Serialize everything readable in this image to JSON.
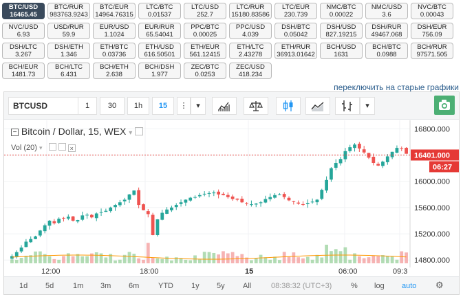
{
  "pairs": [
    {
      "name": "BTC/USD",
      "price": "16465.45",
      "active": true
    },
    {
      "name": "BTC/RUR",
      "price": "983763.9243"
    },
    {
      "name": "BTC/EUR",
      "price": "14964.76315"
    },
    {
      "name": "LTC/BTC",
      "price": "0.01537"
    },
    {
      "name": "LTC/USD",
      "price": "252.7"
    },
    {
      "name": "LTC/RUR",
      "price": "15180.83586"
    },
    {
      "name": "LTC/EUR",
      "price": "230.739"
    },
    {
      "name": "NMC/BTC",
      "price": "0.00022"
    },
    {
      "name": "NMC/USD",
      "price": "3.6"
    },
    {
      "name": "NVC/BTC",
      "price": "0.00043"
    },
    {
      "name": "NVC/USD",
      "price": "6.93"
    },
    {
      "name": "USD/RUR",
      "price": "59.9"
    },
    {
      "name": "EUR/USD",
      "price": "1.1024"
    },
    {
      "name": "EUR/RUR",
      "price": "65.54041"
    },
    {
      "name": "PPC/BTC",
      "price": "0.00025"
    },
    {
      "name": "PPC/USD",
      "price": "4.039"
    },
    {
      "name": "DSH/BTC",
      "price": "0.05042"
    },
    {
      "name": "DSH/USD",
      "price": "827.19215"
    },
    {
      "name": "DSH/RUR",
      "price": "49467.068"
    },
    {
      "name": "DSH/EUR",
      "price": "756.09"
    },
    {
      "name": "DSH/LTC",
      "price": "3.267"
    },
    {
      "name": "DSH/ETH",
      "price": "1.346"
    },
    {
      "name": "ETH/BTC",
      "price": "0.03736"
    },
    {
      "name": "ETH/USD",
      "price": "616.50501"
    },
    {
      "name": "ETH/EUR",
      "price": "561.12415"
    },
    {
      "name": "ETH/LTC",
      "price": "2.43278"
    },
    {
      "name": "ETH/RUR",
      "price": "36913.01642"
    },
    {
      "name": "BCH/USD",
      "price": "1631"
    },
    {
      "name": "BCH/BTC",
      "price": "0.0988"
    },
    {
      "name": "BCH/RUR",
      "price": "97571.505"
    },
    {
      "name": "BCH/EUR",
      "price": "1481.73"
    },
    {
      "name": "BCH/LTC",
      "price": "6.431"
    },
    {
      "name": "BCH/ETH",
      "price": "2.638"
    },
    {
      "name": "BCH/DSH",
      "price": "1.977"
    },
    {
      "name": "ZEC/BTC",
      "price": "0.0253"
    },
    {
      "name": "ZEC/USD",
      "price": "418.234"
    }
  ],
  "switch_link": "переключить на старые графики",
  "toolbar": {
    "symbol": "BTCUSD",
    "intervals": [
      "1",
      "30",
      "1h",
      "15"
    ],
    "active_interval": "15"
  },
  "legend": {
    "title": "Bitcoin / Dollar, 15, WEX",
    "volume": "Vol (20)"
  },
  "price_axis": {
    "ticks": [
      "16800.000",
      "16400.000",
      "16000.000",
      "15600.000",
      "15200.000",
      "14800.000"
    ],
    "current_price": "16401.000",
    "countdown": "06:27"
  },
  "time_axis": [
    "12:00",
    "18:00",
    "15",
    "06:00",
    "09:3"
  ],
  "bottom": {
    "ranges": [
      "1d",
      "5d",
      "1m",
      "3m",
      "6m",
      "YTD",
      "1y",
      "5y",
      "All"
    ],
    "clock": "08:38:32 (UTC+3)",
    "percent": "%",
    "log": "log",
    "auto": "auto"
  },
  "colors": {
    "up": "#26a69a",
    "down": "#ef5350",
    "price_line": "#e53935",
    "accent": "#2196f3",
    "active_pair_bg": "#3a4a5c"
  },
  "chart_data": {
    "type": "candlestick",
    "title": "Bitcoin / Dollar, 15, WEX",
    "ylim": [
      14750,
      16930
    ],
    "last_price": 16401,
    "close_approx": [
      14860,
      14920,
      14990,
      15080,
      15120,
      15160,
      15250,
      15330,
      15400,
      15360,
      15430,
      15440,
      15460,
      15400,
      15410,
      15480,
      15490,
      15450,
      15510,
      15530,
      15550,
      15600,
      15640,
      15680,
      15720,
      15800,
      15860,
      15640,
      15560,
      15500,
      15180,
      15420,
      15520,
      15570,
      15600,
      15640,
      15680,
      15720,
      15750,
      15760,
      15790,
      15810,
      15820,
      15830,
      15800,
      15790,
      15760,
      15730,
      15720,
      15680,
      15660,
      15650,
      15660,
      15680,
      15730,
      15760,
      15790,
      15800,
      15760,
      15710,
      15690,
      15660,
      15650,
      15670,
      15690,
      15720,
      15870,
      16020,
      16200,
      16280,
      16340,
      16460,
      16520,
      16560,
      16500,
      16440,
      16360,
      16280,
      16240,
      16300,
      16380,
      16450,
      16510,
      16500,
      16420
    ]
  }
}
